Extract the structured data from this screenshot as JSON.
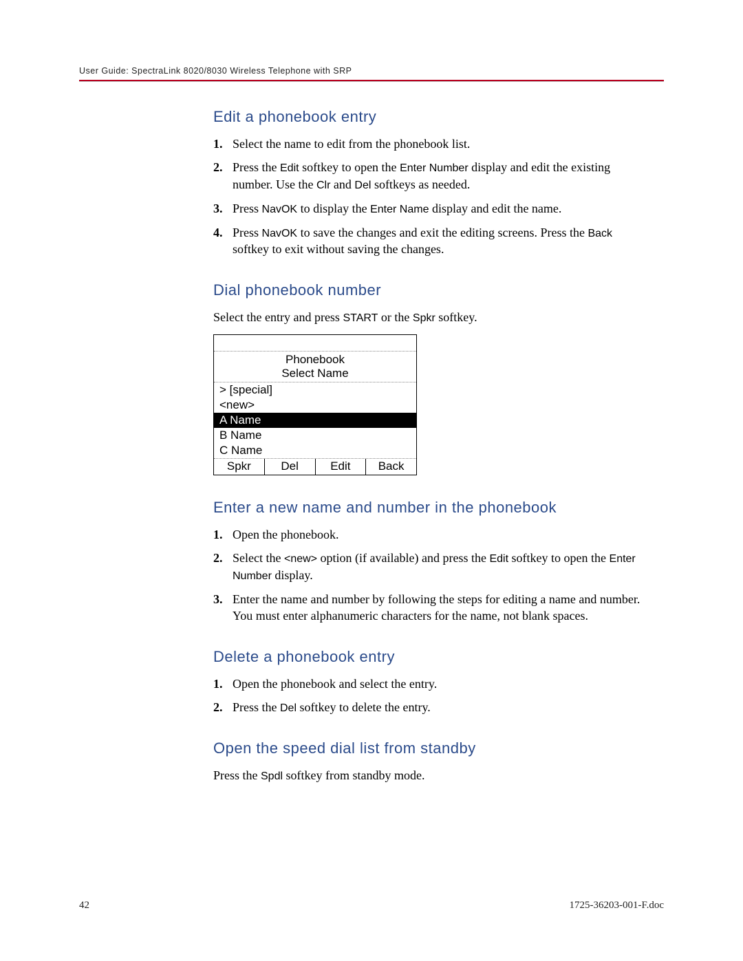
{
  "header": {
    "text": "User Guide: SpectraLink 8020/8030 Wireless Telephone with SRP"
  },
  "sections": {
    "edit": {
      "heading": "Edit a phonebook entry",
      "step1": "Select the name to edit from the phonebook list.",
      "step2_a": "Press the ",
      "step2_edit": "Edit",
      "step2_b": " softkey to open the ",
      "step2_enternum": "Enter Number",
      "step2_c": " display and edit the existing number. Use the ",
      "step2_clr": "Clr",
      "step2_d": " and ",
      "step2_del": "Del",
      "step2_e": " softkeys as needed.",
      "step3_a": "Press ",
      "step3_navok": "NavOK",
      "step3_b": " to display the ",
      "step3_entername": "Enter Name",
      "step3_c": " display and edit the name.",
      "step4_a": "Press ",
      "step4_navok": "NavOK",
      "step4_b": " to save the changes and exit the editing screens. Press the ",
      "step4_back": "Back",
      "step4_c": " softkey to exit without saving the changes."
    },
    "dial": {
      "heading": "Dial phonebook number",
      "body_a": "Select the entry and press ",
      "body_start": "START",
      "body_b": " or the ",
      "body_spkr": "Spkr",
      "body_c": " softkey."
    },
    "phone": {
      "title": "Phonebook",
      "subtitle": "Select Name",
      "rows": {
        "r0": "> [special]",
        "r1": "<new>",
        "r2": "A Name",
        "r3": "B Name",
        "r4": "C Name"
      },
      "softkeys": {
        "k0": "Spkr",
        "k1": "Del",
        "k2": "Edit",
        "k3": "Back"
      }
    },
    "enter": {
      "heading": "Enter a new name and number in the phonebook",
      "step1": "Open the phonebook.",
      "step2_a": "Select the ",
      "step2_new": "<new>",
      "step2_b": " option (if available) and press the ",
      "step2_edit": "Edit",
      "step2_c": " softkey to open the ",
      "step2_enternum": "Enter Number",
      "step2_d": " display.",
      "step3": "Enter the name and number by following the steps for editing a name and number. You must enter alphanumeric characters for the name, not blank spaces."
    },
    "delete": {
      "heading": "Delete a phonebook entry",
      "step1": "Open the phonebook and select the entry.",
      "step2_a": "Press the ",
      "step2_del": "Del",
      "step2_b": " softkey to delete the entry."
    },
    "speed": {
      "heading": "Open the speed dial list from standby",
      "body_a": "Press the ",
      "body_spdl": "Spdl",
      "body_b": " softkey from standby mode."
    }
  },
  "footer": {
    "page": "42",
    "doc": "1725-36203-001-F.doc"
  }
}
